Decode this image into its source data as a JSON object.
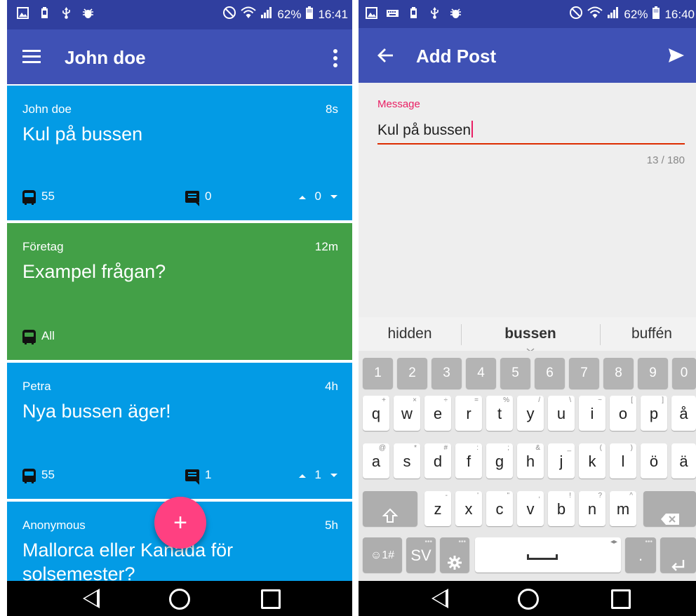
{
  "feed_screen": {
    "status": {
      "battery": "62%",
      "time": "16:41"
    },
    "appbar": {
      "title": "John doe"
    },
    "posts": [
      {
        "author": "John doe",
        "time": "8s",
        "message": "Kul på bussen",
        "bus": "55",
        "comments": "0",
        "votes": "0",
        "color": "#039be5"
      },
      {
        "author": "Företag",
        "time": "12m",
        "message": "Exampel frågan?",
        "bus": "All",
        "color": "#43a047"
      },
      {
        "author": "Petra",
        "time": "4h",
        "message": "Nya bussen äger!",
        "bus": "55",
        "comments": "1",
        "votes": "1",
        "color": "#039be5"
      },
      {
        "author": "Anonymous",
        "time": "5h",
        "message": "Mallorca eller Kanada för solsemester?",
        "color": "#039be5"
      }
    ],
    "fab": {
      "label": "+"
    }
  },
  "compose_screen": {
    "status": {
      "battery": "62%",
      "time": "16:40"
    },
    "appbar": {
      "title": "Add Post"
    },
    "message_field": {
      "label": "Message",
      "value": "Kul på bussen",
      "counter": "13 / 180"
    },
    "suggestions": [
      "hidden",
      "bussen",
      "buffén"
    ],
    "keyboard": {
      "number_row": [
        "1",
        "2",
        "3",
        "4",
        "5",
        "6",
        "7",
        "8",
        "9",
        "0"
      ],
      "row1": [
        "q",
        "w",
        "e",
        "r",
        "t",
        "y",
        "u",
        "i",
        "o",
        "p",
        "å"
      ],
      "row1_hints": [
        "+",
        "×",
        "÷",
        "=",
        "%",
        "/",
        "\\",
        "~",
        "[",
        "]",
        ""
      ],
      "row2": [
        "a",
        "s",
        "d",
        "f",
        "g",
        "h",
        "j",
        "k",
        "l",
        "ö",
        "ä"
      ],
      "row2_hints": [
        "@",
        "*",
        "#",
        ":",
        ";",
        "&",
        "_",
        "(",
        ")",
        "",
        ""
      ],
      "row3": [
        "z",
        "x",
        "c",
        "v",
        "b",
        "n",
        "m"
      ],
      "row3_hints": [
        "-",
        "'",
        "\"",
        ",",
        "!",
        "?",
        "^"
      ],
      "symbols_key": "☺1#",
      "language_key": "SV",
      "period_key": "."
    }
  },
  "colors": {
    "primary": "#3f51b5",
    "primary_dark": "#303f9f",
    "accent": "#ff4081",
    "post_blue": "#039be5",
    "post_green": "#43a047"
  }
}
